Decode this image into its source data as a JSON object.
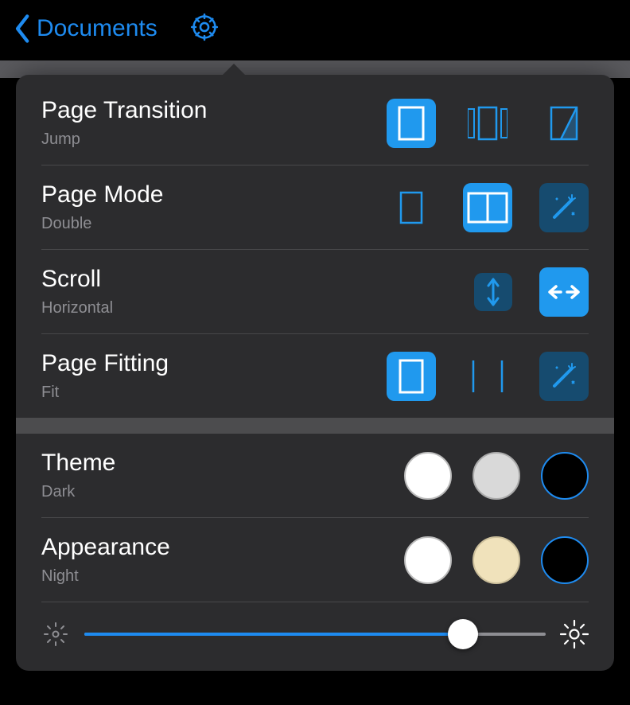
{
  "header": {
    "back_label": "Documents"
  },
  "settings": {
    "page_transition": {
      "title": "Page Transition",
      "value": "Jump"
    },
    "page_mode": {
      "title": "Page Mode",
      "value": "Double"
    },
    "scroll": {
      "title": "Scroll",
      "value": "Horizontal"
    },
    "page_fitting": {
      "title": "Page Fitting",
      "value": "Fit"
    },
    "theme": {
      "title": "Theme",
      "value": "Dark",
      "options": [
        "White",
        "Gray",
        "Dark"
      ],
      "selected_index": 2
    },
    "appearance": {
      "title": "Appearance",
      "value": "Night",
      "options": [
        "White",
        "Sepia",
        "Night"
      ],
      "selected_index": 2
    },
    "brightness": {
      "value": 0.82
    }
  },
  "colors": {
    "accent": "#1e8bf0",
    "option_accent": "#2099ee",
    "panel_bg": "#2c2c2e",
    "muted_text": "#8e8e93"
  }
}
